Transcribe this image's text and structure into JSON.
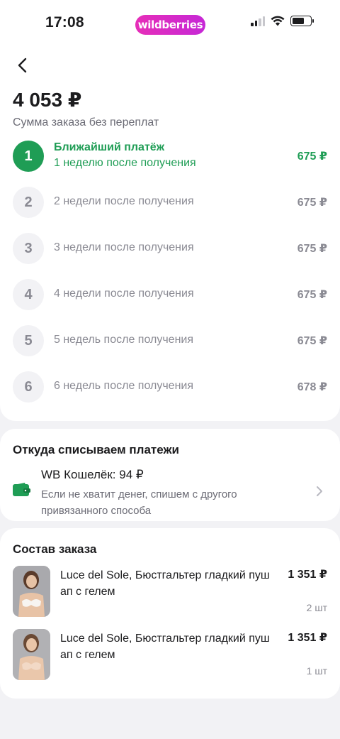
{
  "status_bar": {
    "time": "17:08",
    "brand": "wildberries"
  },
  "order": {
    "total": "4 053 ₽",
    "caption": "Сумма заказа без переплат"
  },
  "payments": [
    {
      "number": "1",
      "title": "Ближайший платёж",
      "subtitle": "1 неделю после получения",
      "amount": "675 ₽"
    },
    {
      "number": "2",
      "title": "2 недели после получения",
      "amount": "675 ₽"
    },
    {
      "number": "3",
      "title": "3 недели после получения",
      "amount": "675 ₽"
    },
    {
      "number": "4",
      "title": "4 недели после получения",
      "amount": "675 ₽"
    },
    {
      "number": "5",
      "title": "5 недель после получения",
      "amount": "675 ₽"
    },
    {
      "number": "6",
      "title": "6 недель после получения",
      "amount": "678 ₽"
    }
  ],
  "payment_source": {
    "title": "Откуда списываем платежи",
    "wallet_name": "WB Кошелёк: 94 ₽",
    "note": "Если не хватит денег, спишем с другого привязанного способа"
  },
  "order_items": {
    "title": "Состав заказа",
    "items": [
      {
        "name": "Luce del Sole, Бюстгальтер гладкий пуш ап с гелем",
        "price": "1 351 ₽",
        "qty": "2 шт"
      },
      {
        "name": "Luce del Sole, Бюстгальтер гладкий пуш ап с гелем",
        "price": "1 351 ₽",
        "qty": "1 шт"
      }
    ]
  },
  "icons": {
    "back": "chevron-left-icon",
    "wallet": "wallet-icon",
    "chevron": "chevron-right-icon"
  },
  "colors": {
    "accent_green": "#1f9d55",
    "brand_pink": "#e62eb8",
    "muted": "#8a8a93"
  }
}
